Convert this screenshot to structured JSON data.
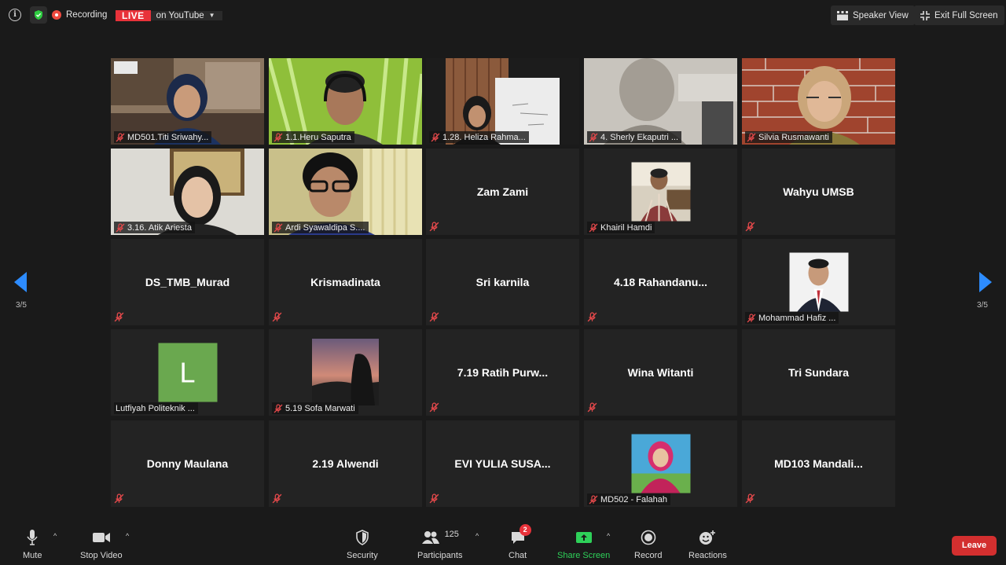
{
  "topbar": {
    "info_icon": "info-circle-icon",
    "security_icon": "shield-check-icon",
    "recording_label": "Recording",
    "live_badge": "LIVE",
    "youtube_label": "on YouTube",
    "speaker_view_label": "Speaker View",
    "exit_fullscreen_label": "Exit Full Screen"
  },
  "navigation": {
    "left_page": "3/5",
    "right_page": "3/5"
  },
  "participants": [
    {
      "name": "MD501.Titi Sriwahy...",
      "type": "video"
    },
    {
      "name": "1.1.Heru Saputra",
      "type": "video"
    },
    {
      "name": "1.28. Heliza Rahma...",
      "type": "video"
    },
    {
      "name": "4. Sherly Ekaputri ...",
      "type": "video"
    },
    {
      "name": "Silvia Rusmawanti",
      "type": "video"
    },
    {
      "name": "3.16. Atik Ariesta",
      "type": "video"
    },
    {
      "name": "Ardi Syawaldipa S....",
      "type": "video"
    },
    {
      "name": "Zam Zami",
      "type": "name"
    },
    {
      "name": "Khairil Hamdi",
      "type": "photo"
    },
    {
      "name": "Wahyu UMSB",
      "type": "name"
    },
    {
      "name": "DS_TMB_Murad",
      "type": "name"
    },
    {
      "name": "Krismadinata",
      "type": "name"
    },
    {
      "name": "Sri karnila",
      "type": "name"
    },
    {
      "name": "4.18  Rahandanu...",
      "type": "name"
    },
    {
      "name": "Mohammad Hafiz ...",
      "type": "photo"
    },
    {
      "name": "Lutfiyah Politeknik ...",
      "type": "initial",
      "initial": "L"
    },
    {
      "name": "5.19 Sofa Marwati",
      "type": "photo"
    },
    {
      "name": "7.19  Ratih Purw...",
      "type": "name"
    },
    {
      "name": "Wina Witanti",
      "type": "name"
    },
    {
      "name": "Tri Sundara",
      "type": "name"
    },
    {
      "name": "Donny Maulana",
      "type": "name"
    },
    {
      "name": "2.19 Alwendi",
      "type": "name"
    },
    {
      "name": "EVI YULIA SUSA...",
      "type": "name"
    },
    {
      "name": "MD502 - Falahah",
      "type": "photo"
    },
    {
      "name": "MD103  Mandali...",
      "type": "name"
    }
  ],
  "toolbar": {
    "mute_label": "Mute",
    "stop_video_label": "Stop Video",
    "security_label": "Security",
    "participants_label": "Participants",
    "participants_count": "125",
    "chat_label": "Chat",
    "chat_badge": "2",
    "share_screen_label": "Share Screen",
    "record_label": "Record",
    "reactions_label": "Reactions",
    "leave_label": "Leave"
  },
  "colors": {
    "background": "#1a1a1a",
    "tile": "#232323",
    "live_red": "#e8323a",
    "accent_blue": "#2d8cff",
    "share_green": "#2ed159",
    "leave_red": "#d32f2f",
    "muted_mic_red": "#e0484a"
  }
}
